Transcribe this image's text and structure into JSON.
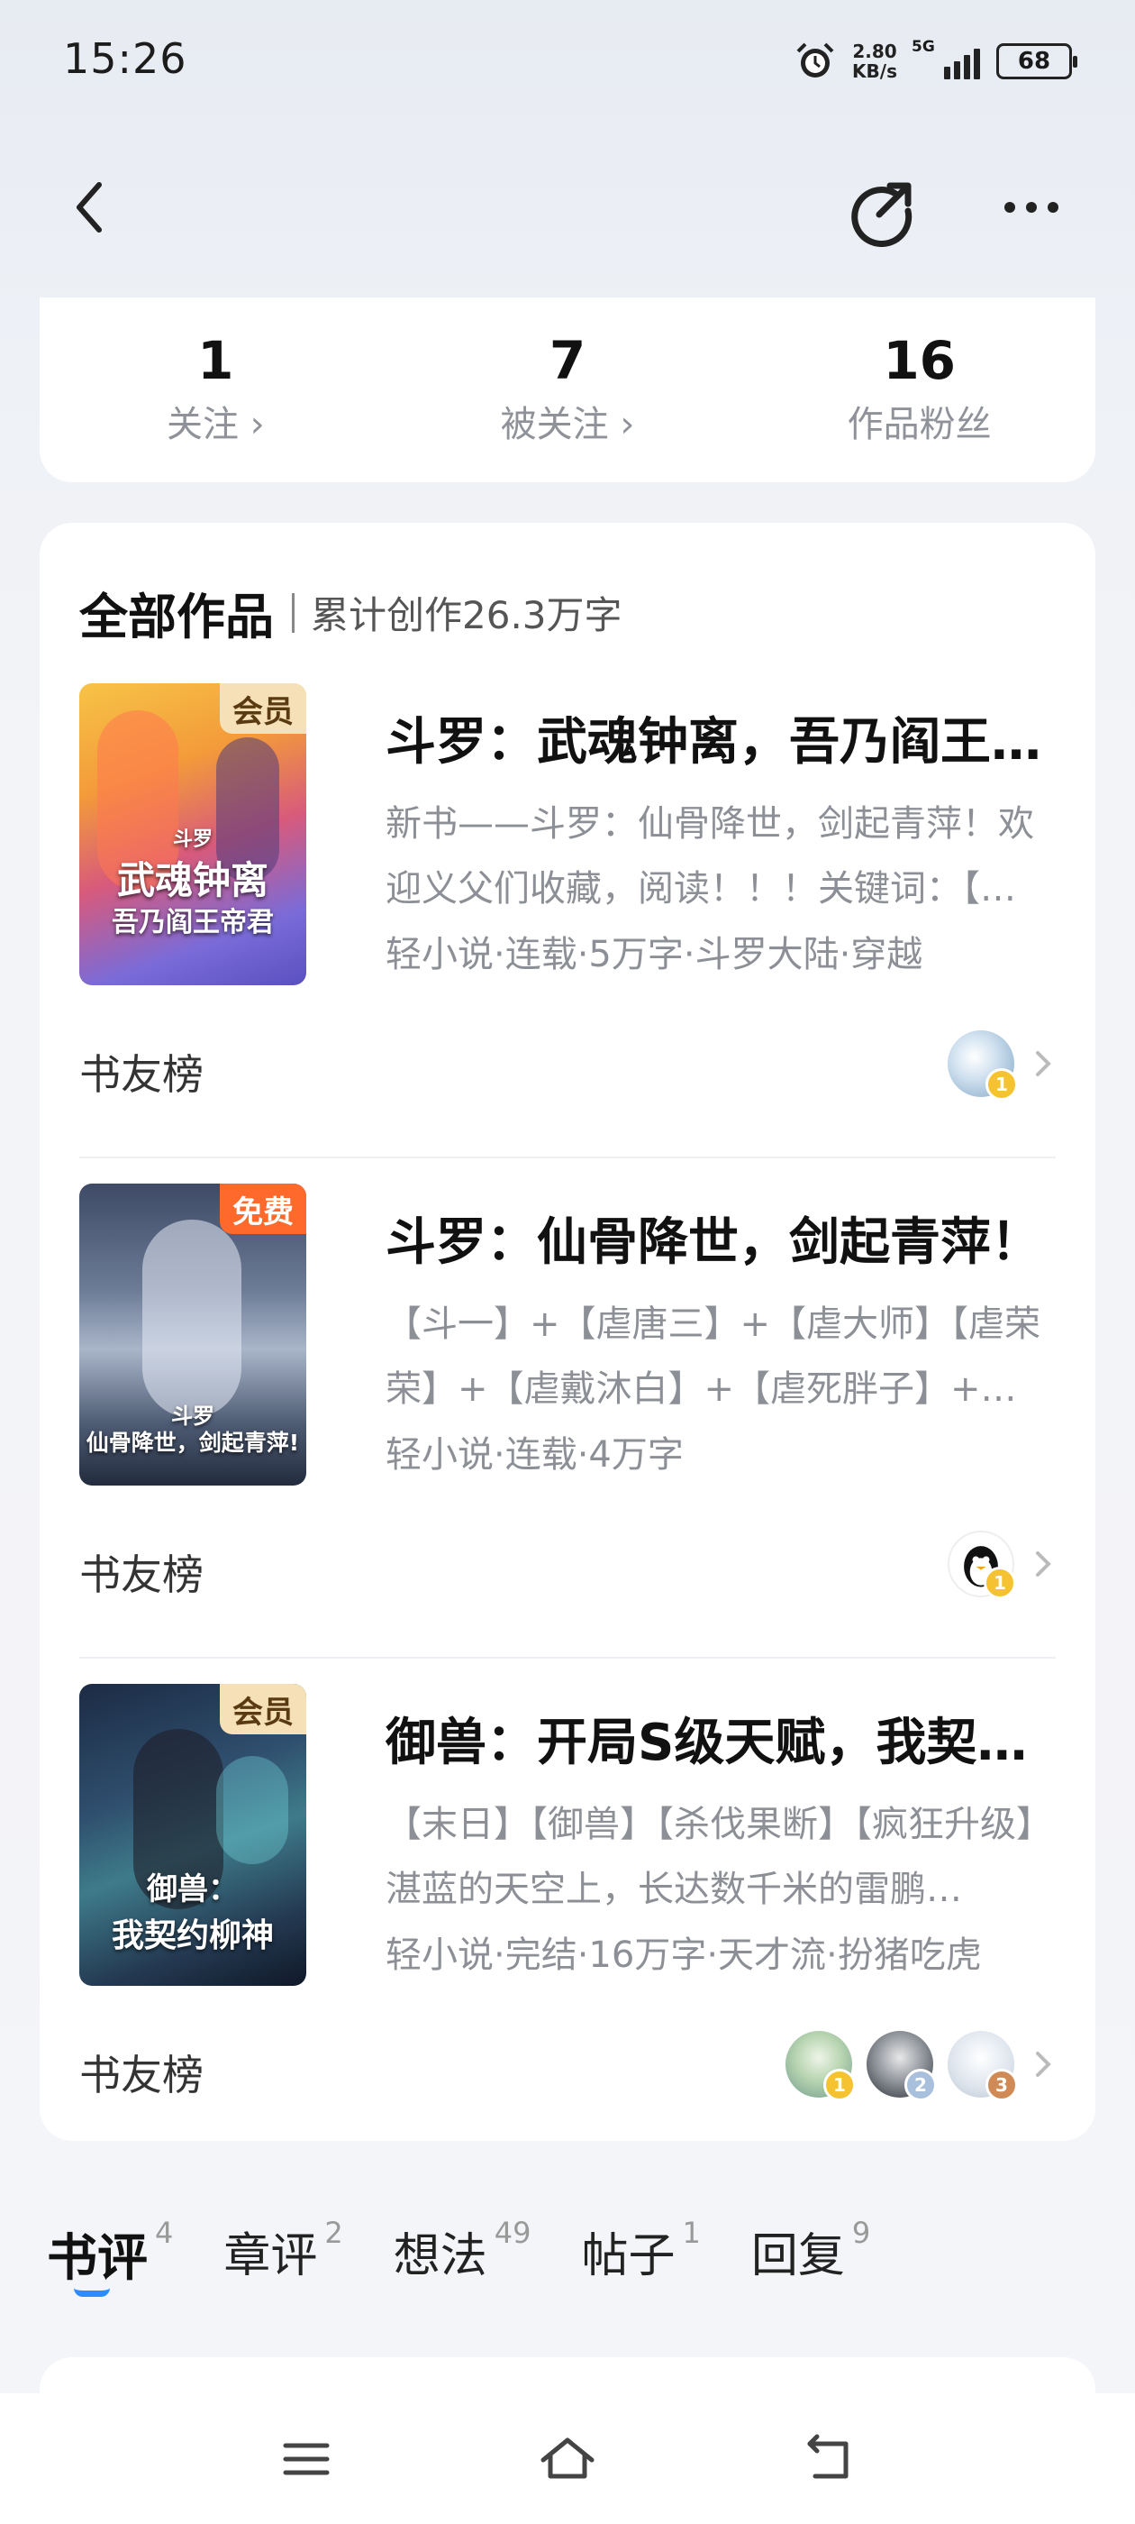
{
  "status_bar": {
    "time": "15:26",
    "speed_value": "2.80",
    "speed_unit": "KB/s",
    "network": "5G",
    "battery": "68"
  },
  "stats": [
    {
      "value": "1",
      "label": "关注 ›"
    },
    {
      "value": "7",
      "label": "被关注 ›"
    },
    {
      "value": "16",
      "label": "作品粉丝"
    }
  ],
  "works": {
    "title": "全部作品",
    "subtitle": "累计创作26.3万字",
    "books": [
      {
        "tag": "会员",
        "tag_type": "vip",
        "cover_lines": [
          "斗罗",
          "武魂钟离",
          "吾乃阎王帝君"
        ],
        "name": "斗罗：武魂钟离，吾乃阎王…",
        "desc": "新书——斗罗：仙骨降世，剑起青萍！欢迎义父们收藏，阅读！！！关键词：【…",
        "meta": "轻小说·连载·5万字·斗罗大陆·穿越",
        "rank_label": "书友榜"
      },
      {
        "tag": "免费",
        "tag_type": "free",
        "cover_lines": [
          "斗罗",
          "仙骨降世，剑起青萍!"
        ],
        "name": "斗罗：仙骨降世，剑起青萍！",
        "desc": "【斗一】+【虐唐三】+【虐大师】【虐荣荣】+【虐戴沐白】+【虐死胖子】+…",
        "meta": "轻小说·连载·4万字",
        "rank_label": "书友榜"
      },
      {
        "tag": "会员",
        "tag_type": "vip",
        "cover_lines": [
          "御兽：",
          "我契约柳神"
        ],
        "name": "御兽：开局S级天赋，我契约…",
        "desc": "【末日】【御兽】【杀伐果断】【疯狂升级】湛蓝的天空上，长达数千米的雷鹏…",
        "meta": "轻小说·完结·16万字·天才流·扮猪吃虎",
        "rank_label": "书友榜"
      }
    ]
  },
  "tabs": [
    {
      "label": "书评",
      "count": "4"
    },
    {
      "label": "章评",
      "count": "2"
    },
    {
      "label": "想法",
      "count": "49"
    },
    {
      "label": "帖子",
      "count": "1"
    },
    {
      "label": "回复",
      "count": "9"
    }
  ],
  "colors": {
    "accent": "#2a8cff",
    "vip_tag": "#f5e0b7",
    "free_tag": "#ff6a2c",
    "medal_gold": "#f5c232",
    "medal_silver": "#a9c0dc",
    "medal_bronze": "#d08a55"
  },
  "icons": {
    "back": "chevron-left-icon",
    "share": "share-icon",
    "more": "more-dots-icon",
    "menu": "menu-icon",
    "home": "home-icon",
    "return": "return-icon"
  }
}
